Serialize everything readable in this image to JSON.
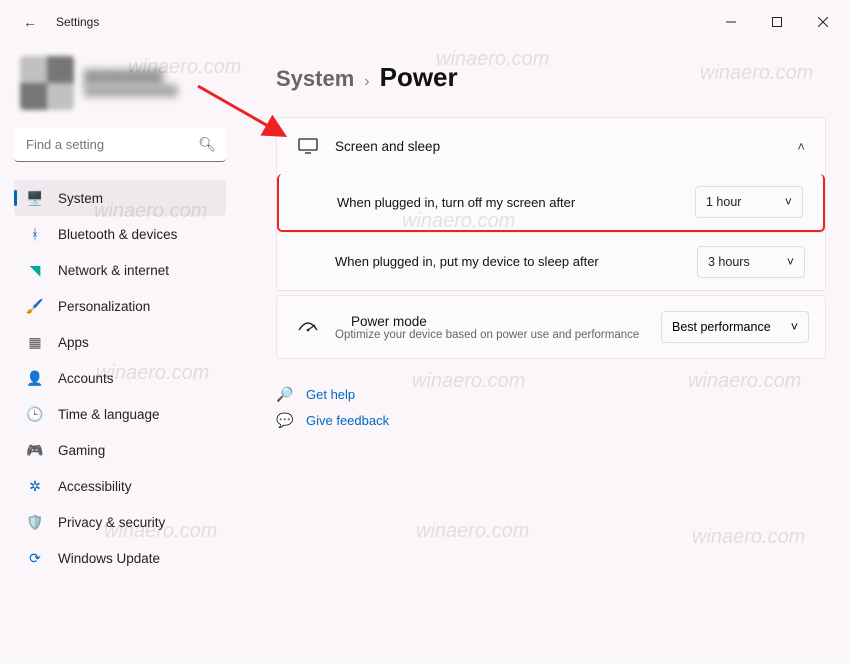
{
  "window": {
    "title": "Settings"
  },
  "user": {
    "name": "████████",
    "email": "████████████"
  },
  "search": {
    "placeholder": "Find a setting"
  },
  "sidebar": {
    "items": [
      {
        "label": "System",
        "selected": true
      },
      {
        "label": "Bluetooth & devices"
      },
      {
        "label": "Network & internet"
      },
      {
        "label": "Personalization"
      },
      {
        "label": "Apps"
      },
      {
        "label": "Accounts"
      },
      {
        "label": "Time & language"
      },
      {
        "label": "Gaming"
      },
      {
        "label": "Accessibility"
      },
      {
        "label": "Privacy & security"
      },
      {
        "label": "Windows Update"
      }
    ]
  },
  "breadcrumb": {
    "parent": "System",
    "sep": "›",
    "current": "Power"
  },
  "screenSleep": {
    "title": "Screen and sleep",
    "rows": [
      {
        "label": "When plugged in, turn off my screen after",
        "value": "1 hour"
      },
      {
        "label": "When plugged in, put my device to sleep after",
        "value": "3 hours"
      }
    ]
  },
  "powerMode": {
    "title": "Power mode",
    "sub": "Optimize your device based on power use and performance",
    "value": "Best performance"
  },
  "links": {
    "help": "Get help",
    "feedback": "Give feedback"
  },
  "watermark": "winaero.com"
}
